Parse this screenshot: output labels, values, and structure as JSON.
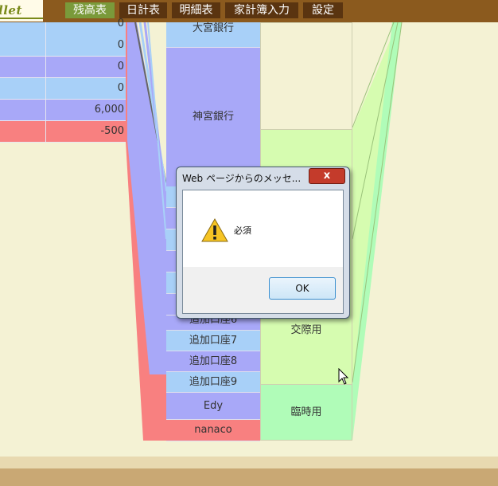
{
  "logo": {
    "text": "llet"
  },
  "nav": {
    "tabs": [
      {
        "label": "残高表",
        "active": true
      },
      {
        "label": "日計表",
        "active": false
      },
      {
        "label": "明細表",
        "active": false
      },
      {
        "label": "家計簿入力",
        "active": false
      },
      {
        "label": "設定",
        "active": false
      }
    ]
  },
  "balances": {
    "rows": [
      {
        "value": "0",
        "color": "#a8d0f8"
      },
      {
        "value": "0",
        "color": "#a8a8f8"
      },
      {
        "value": "0",
        "color": "#a8d0f8"
      },
      {
        "value": "6,000",
        "color": "#a8a8f8"
      },
      {
        "value": "-500",
        "color": "#f88080"
      }
    ]
  },
  "accounts": {
    "items": [
      {
        "label": "大宮銀行",
        "color": "#a8d0f8"
      },
      {
        "label": "神宮銀行",
        "color": "#a8a8f8"
      },
      {
        "label": "追加口座6",
        "color": "#a8a8f8"
      },
      {
        "label": "追加口座7",
        "color": "#a8d0f8"
      },
      {
        "label": "追加口座8",
        "color": "#a8a8f8"
      },
      {
        "label": "追加口座9",
        "color": "#a8d0f8"
      },
      {
        "label": "Edy",
        "color": "#a8a8f8"
      },
      {
        "label": "nanaco",
        "color": "#f88080"
      }
    ]
  },
  "categories": {
    "items": [
      {
        "label": "交際用",
        "color": "#d6fcb0"
      },
      {
        "label": "臨時用",
        "color": "#b0fcb8"
      }
    ]
  },
  "dialog": {
    "title": "Web ページからのメッセ...",
    "close_label": "x",
    "message": "必須",
    "ok_label": "OK"
  }
}
